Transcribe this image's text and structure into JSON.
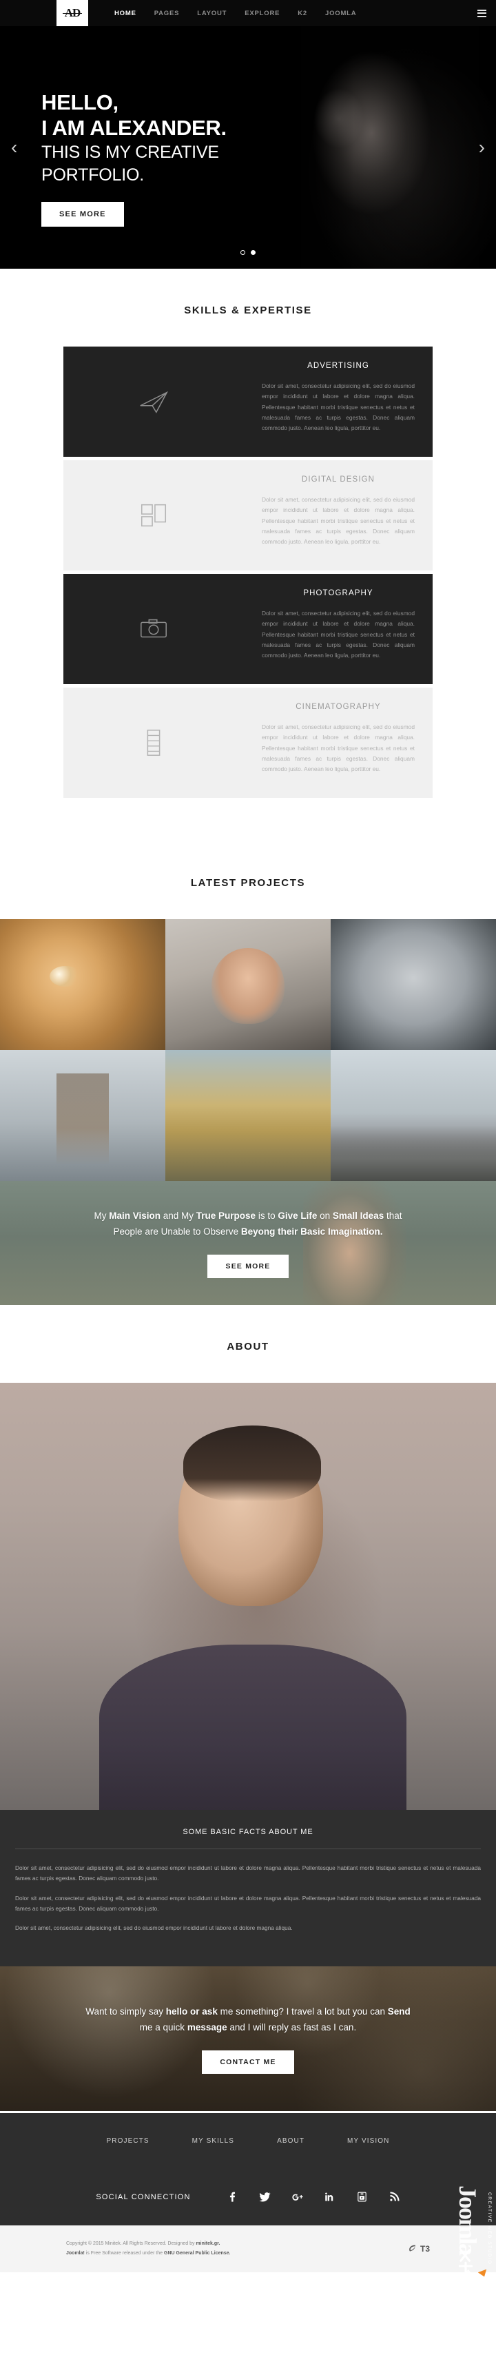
{
  "header": {
    "logo": "AD",
    "nav": [
      {
        "label": "HOME",
        "active": true
      },
      {
        "label": "PAGES",
        "active": false
      },
      {
        "label": "LAYOUT",
        "active": false
      },
      {
        "label": "EXPLORE",
        "active": false
      },
      {
        "label": "K2",
        "active": false
      },
      {
        "label": "JOOMLA",
        "active": false
      }
    ],
    "menu_icon": "hamburger-icon"
  },
  "hero": {
    "line1": "HELLO,",
    "line2": "I AM ALEXANDER.",
    "line3": "THIS IS MY CREATIVE",
    "line4": "PORTFOLIO.",
    "button": "SEE MORE",
    "prev_icon": "chevron-left-icon",
    "next_icon": "chevron-right-icon",
    "slides": 2,
    "active_slide": 2
  },
  "skills": {
    "title": "SKILLS & EXPERTISE",
    "body_text": "Dolor sit amet, consectetur adipisicing elit, sed do eiusmod empor incididunt ut labore et dolore magna aliqua. Pellentesque habitant morbi tristique senectus et netus et malesuada fames ac turpis egestas. Donec aliquam commodo justo. Aenean leo ligula, porttitor eu.",
    "items": [
      {
        "name": "ADVERTISING",
        "theme": "dark",
        "icon": "paper-plane-icon"
      },
      {
        "name": "DIGITAL DESIGN",
        "theme": "light",
        "icon": "layout-grid-icon"
      },
      {
        "name": "PHOTOGRAPHY",
        "theme": "dark",
        "icon": "camera-icon"
      },
      {
        "name": "CINEMATOGRAPHY",
        "theme": "light",
        "icon": "film-reel-icon"
      }
    ]
  },
  "projects": {
    "title": "LATEST PROJECTS",
    "items": [
      {
        "name": "cat-portrait",
        "style": "proj-cat"
      },
      {
        "name": "woman-hat-portrait",
        "style": "proj-woman"
      },
      {
        "name": "weimaraner-dog",
        "style": "proj-dog"
      },
      {
        "name": "giraffes",
        "style": "proj-giraffe"
      },
      {
        "name": "canyon-landscape",
        "style": "proj-canyon"
      },
      {
        "name": "birds-on-rocks",
        "style": "proj-birds"
      }
    ]
  },
  "vision": {
    "text_parts": [
      {
        "t": "My ",
        "b": false
      },
      {
        "t": "Main Vision",
        "b": true
      },
      {
        "t": " and My ",
        "b": false
      },
      {
        "t": "True Purpose",
        "b": true
      },
      {
        "t": " is to ",
        "b": false
      },
      {
        "t": "Give Life",
        "b": true
      },
      {
        "t": " on ",
        "b": false
      },
      {
        "t": "Small Ideas",
        "b": true
      },
      {
        "t": " that People are Unable to Observe ",
        "b": false
      },
      {
        "t": "Beyong their Basic Imagination.",
        "b": true
      }
    ],
    "button": "SEE MORE"
  },
  "about": {
    "title": "ABOUT",
    "facts_title": "SOME BASIC FACTS ABOUT ME",
    "paragraph1": "Dolor sit amet, consectetur adipisicing elit, sed do eiusmod empor incididunt ut labore et dolore magna aliqua. Pellentesque habitant morbi tristique senectus et netus et malesuada fames ac turpis egestas. Donec aliquam commodo justo.",
    "paragraph2": "Dolor sit amet, consectetur adipisicing elit, sed do eiusmod empor incididunt ut labore et dolore magna aliqua. Pellentesque habitant morbi tristique senectus et netus et malesuada fames ac turpis egestas. Donec aliquam commodo justo.",
    "paragraph3": "Dolor sit amet, consectetur adipisicing elit, sed do eiusmod empor incididunt ut labore et dolore magna aliqua."
  },
  "contact": {
    "text_parts": [
      {
        "t": "Want to simply say ",
        "b": false
      },
      {
        "t": "hello or ask",
        "b": true
      },
      {
        "t": " me something? I travel a lot but you can ",
        "b": false
      },
      {
        "t": "Send",
        "b": true
      },
      {
        "t": " me a quick ",
        "b": false
      },
      {
        "t": "message",
        "b": true
      },
      {
        "t": " and I will reply as fast as I can.",
        "b": false
      }
    ],
    "button": "CONTACT ME"
  },
  "footer": {
    "nav": [
      "PROJECTS",
      "MY SKILLS",
      "ABOUT",
      "MY VISION"
    ],
    "social_label": "SOCIAL CONNECTION",
    "social_icons": [
      "facebook-icon",
      "twitter-icon",
      "google-plus-icon",
      "linkedin-icon",
      "youtube-icon",
      "rss-icon"
    ],
    "copyright_line1_a": "Copyright © 2015 Minitek. All Rights Reserved. Designed by ",
    "copyright_line1_b": "minitek.gr.",
    "copyright_line2_a": "Joomla!",
    "copyright_line2_b": " is Free Software released under the ",
    "copyright_line2_c": "GNU General Public License.",
    "t3_label": "T3",
    "ribbon_text": "Joomla",
    "ribbon_sub": "CREATIVE WEB STUDIO"
  },
  "colors": {
    "dark": "#222222",
    "light": "#f0f0f0",
    "footer": "#2e2e2e",
    "accent": "#ffffff"
  }
}
